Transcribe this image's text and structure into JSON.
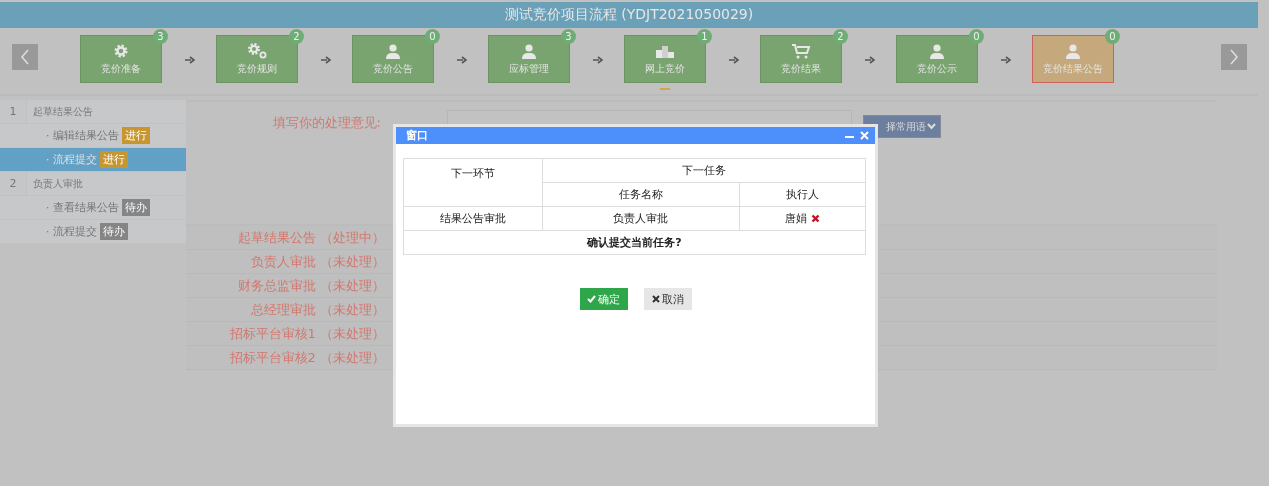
{
  "title": "测试竞价项目流程 (YDJT2021050029)",
  "steps": [
    {
      "label": "竞价准备",
      "count": "3",
      "kind": "gear",
      "selected": false,
      "underline": false
    },
    {
      "label": "竞价规则",
      "count": "2",
      "kind": "gears",
      "selected": false,
      "underline": false
    },
    {
      "label": "竞价公告",
      "count": "0",
      "kind": "person",
      "selected": false,
      "underline": false
    },
    {
      "label": "应标管理",
      "count": "3",
      "kind": "person",
      "selected": false,
      "underline": false
    },
    {
      "label": "网上竞价",
      "count": "1",
      "kind": "podium",
      "selected": false,
      "underline": true
    },
    {
      "label": "竞价结果",
      "count": "2",
      "kind": "cart",
      "selected": false,
      "underline": false
    },
    {
      "label": "竞价公示",
      "count": "0",
      "kind": "person",
      "selected": false,
      "underline": false
    },
    {
      "label": "竞价结果公告",
      "count": "0",
      "kind": "person",
      "selected": true,
      "underline": false
    }
  ],
  "sidebar": [
    {
      "number": "1",
      "label": "起草结果公告",
      "children": [
        {
          "label": "· 编辑结果公告",
          "badge": "进行",
          "kind": "active",
          "selected": false
        },
        {
          "label": "· 流程提交",
          "badge": "进行",
          "kind": "active",
          "selected": true
        }
      ]
    },
    {
      "number": "2",
      "label": "负责人审批",
      "children": [
        {
          "label": "· 查看结果公告",
          "badge": "待办",
          "kind": "pending",
          "selected": false
        },
        {
          "label": "· 流程提交",
          "badge": "待办",
          "kind": "pending",
          "selected": false
        }
      ]
    }
  ],
  "opinion_label": "填写你的处理意见:",
  "phrase_button": "择常用语",
  "flow": [
    "起草结果公告 （处理中）",
    "负责人审批 （未处理）",
    "财务总监审批 （未处理）",
    "总经理审批 （未处理）",
    "招标平台审核1 （未处理）",
    "招标平台审核2 （未处理）"
  ],
  "dialog": {
    "title": "窗口",
    "table": {
      "col_1": "下一环节",
      "col_2": "下一任务",
      "sub_1": "任务名称",
      "sub_2": "执行人",
      "row": {
        "node": "结果公告审批",
        "task": "负责人审批",
        "executor": "唐娟"
      },
      "confirm": "确认提交当前任务?"
    },
    "ok": "确定",
    "cancel": "取消"
  }
}
